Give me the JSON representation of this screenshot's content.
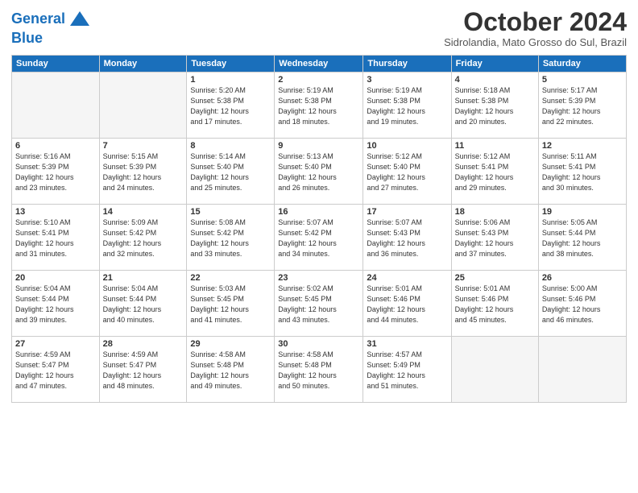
{
  "logo": {
    "line1": "General",
    "line2": "Blue"
  },
  "title": "October 2024",
  "subtitle": "Sidrolandia, Mato Grosso do Sul, Brazil",
  "days_of_week": [
    "Sunday",
    "Monday",
    "Tuesday",
    "Wednesday",
    "Thursday",
    "Friday",
    "Saturday"
  ],
  "weeks": [
    [
      {
        "day": "",
        "info": ""
      },
      {
        "day": "",
        "info": ""
      },
      {
        "day": "1",
        "info": "Sunrise: 5:20 AM\nSunset: 5:38 PM\nDaylight: 12 hours\nand 17 minutes."
      },
      {
        "day": "2",
        "info": "Sunrise: 5:19 AM\nSunset: 5:38 PM\nDaylight: 12 hours\nand 18 minutes."
      },
      {
        "day": "3",
        "info": "Sunrise: 5:19 AM\nSunset: 5:38 PM\nDaylight: 12 hours\nand 19 minutes."
      },
      {
        "day": "4",
        "info": "Sunrise: 5:18 AM\nSunset: 5:38 PM\nDaylight: 12 hours\nand 20 minutes."
      },
      {
        "day": "5",
        "info": "Sunrise: 5:17 AM\nSunset: 5:39 PM\nDaylight: 12 hours\nand 22 minutes."
      }
    ],
    [
      {
        "day": "6",
        "info": "Sunrise: 5:16 AM\nSunset: 5:39 PM\nDaylight: 12 hours\nand 23 minutes."
      },
      {
        "day": "7",
        "info": "Sunrise: 5:15 AM\nSunset: 5:39 PM\nDaylight: 12 hours\nand 24 minutes."
      },
      {
        "day": "8",
        "info": "Sunrise: 5:14 AM\nSunset: 5:40 PM\nDaylight: 12 hours\nand 25 minutes."
      },
      {
        "day": "9",
        "info": "Sunrise: 5:13 AM\nSunset: 5:40 PM\nDaylight: 12 hours\nand 26 minutes."
      },
      {
        "day": "10",
        "info": "Sunrise: 5:12 AM\nSunset: 5:40 PM\nDaylight: 12 hours\nand 27 minutes."
      },
      {
        "day": "11",
        "info": "Sunrise: 5:12 AM\nSunset: 5:41 PM\nDaylight: 12 hours\nand 29 minutes."
      },
      {
        "day": "12",
        "info": "Sunrise: 5:11 AM\nSunset: 5:41 PM\nDaylight: 12 hours\nand 30 minutes."
      }
    ],
    [
      {
        "day": "13",
        "info": "Sunrise: 5:10 AM\nSunset: 5:41 PM\nDaylight: 12 hours\nand 31 minutes."
      },
      {
        "day": "14",
        "info": "Sunrise: 5:09 AM\nSunset: 5:42 PM\nDaylight: 12 hours\nand 32 minutes."
      },
      {
        "day": "15",
        "info": "Sunrise: 5:08 AM\nSunset: 5:42 PM\nDaylight: 12 hours\nand 33 minutes."
      },
      {
        "day": "16",
        "info": "Sunrise: 5:07 AM\nSunset: 5:42 PM\nDaylight: 12 hours\nand 34 minutes."
      },
      {
        "day": "17",
        "info": "Sunrise: 5:07 AM\nSunset: 5:43 PM\nDaylight: 12 hours\nand 36 minutes."
      },
      {
        "day": "18",
        "info": "Sunrise: 5:06 AM\nSunset: 5:43 PM\nDaylight: 12 hours\nand 37 minutes."
      },
      {
        "day": "19",
        "info": "Sunrise: 5:05 AM\nSunset: 5:44 PM\nDaylight: 12 hours\nand 38 minutes."
      }
    ],
    [
      {
        "day": "20",
        "info": "Sunrise: 5:04 AM\nSunset: 5:44 PM\nDaylight: 12 hours\nand 39 minutes."
      },
      {
        "day": "21",
        "info": "Sunrise: 5:04 AM\nSunset: 5:44 PM\nDaylight: 12 hours\nand 40 minutes."
      },
      {
        "day": "22",
        "info": "Sunrise: 5:03 AM\nSunset: 5:45 PM\nDaylight: 12 hours\nand 41 minutes."
      },
      {
        "day": "23",
        "info": "Sunrise: 5:02 AM\nSunset: 5:45 PM\nDaylight: 12 hours\nand 43 minutes."
      },
      {
        "day": "24",
        "info": "Sunrise: 5:01 AM\nSunset: 5:46 PM\nDaylight: 12 hours\nand 44 minutes."
      },
      {
        "day": "25",
        "info": "Sunrise: 5:01 AM\nSunset: 5:46 PM\nDaylight: 12 hours\nand 45 minutes."
      },
      {
        "day": "26",
        "info": "Sunrise: 5:00 AM\nSunset: 5:46 PM\nDaylight: 12 hours\nand 46 minutes."
      }
    ],
    [
      {
        "day": "27",
        "info": "Sunrise: 4:59 AM\nSunset: 5:47 PM\nDaylight: 12 hours\nand 47 minutes."
      },
      {
        "day": "28",
        "info": "Sunrise: 4:59 AM\nSunset: 5:47 PM\nDaylight: 12 hours\nand 48 minutes."
      },
      {
        "day": "29",
        "info": "Sunrise: 4:58 AM\nSunset: 5:48 PM\nDaylight: 12 hours\nand 49 minutes."
      },
      {
        "day": "30",
        "info": "Sunrise: 4:58 AM\nSunset: 5:48 PM\nDaylight: 12 hours\nand 50 minutes."
      },
      {
        "day": "31",
        "info": "Sunrise: 4:57 AM\nSunset: 5:49 PM\nDaylight: 12 hours\nand 51 minutes."
      },
      {
        "day": "",
        "info": ""
      },
      {
        "day": "",
        "info": ""
      }
    ]
  ]
}
